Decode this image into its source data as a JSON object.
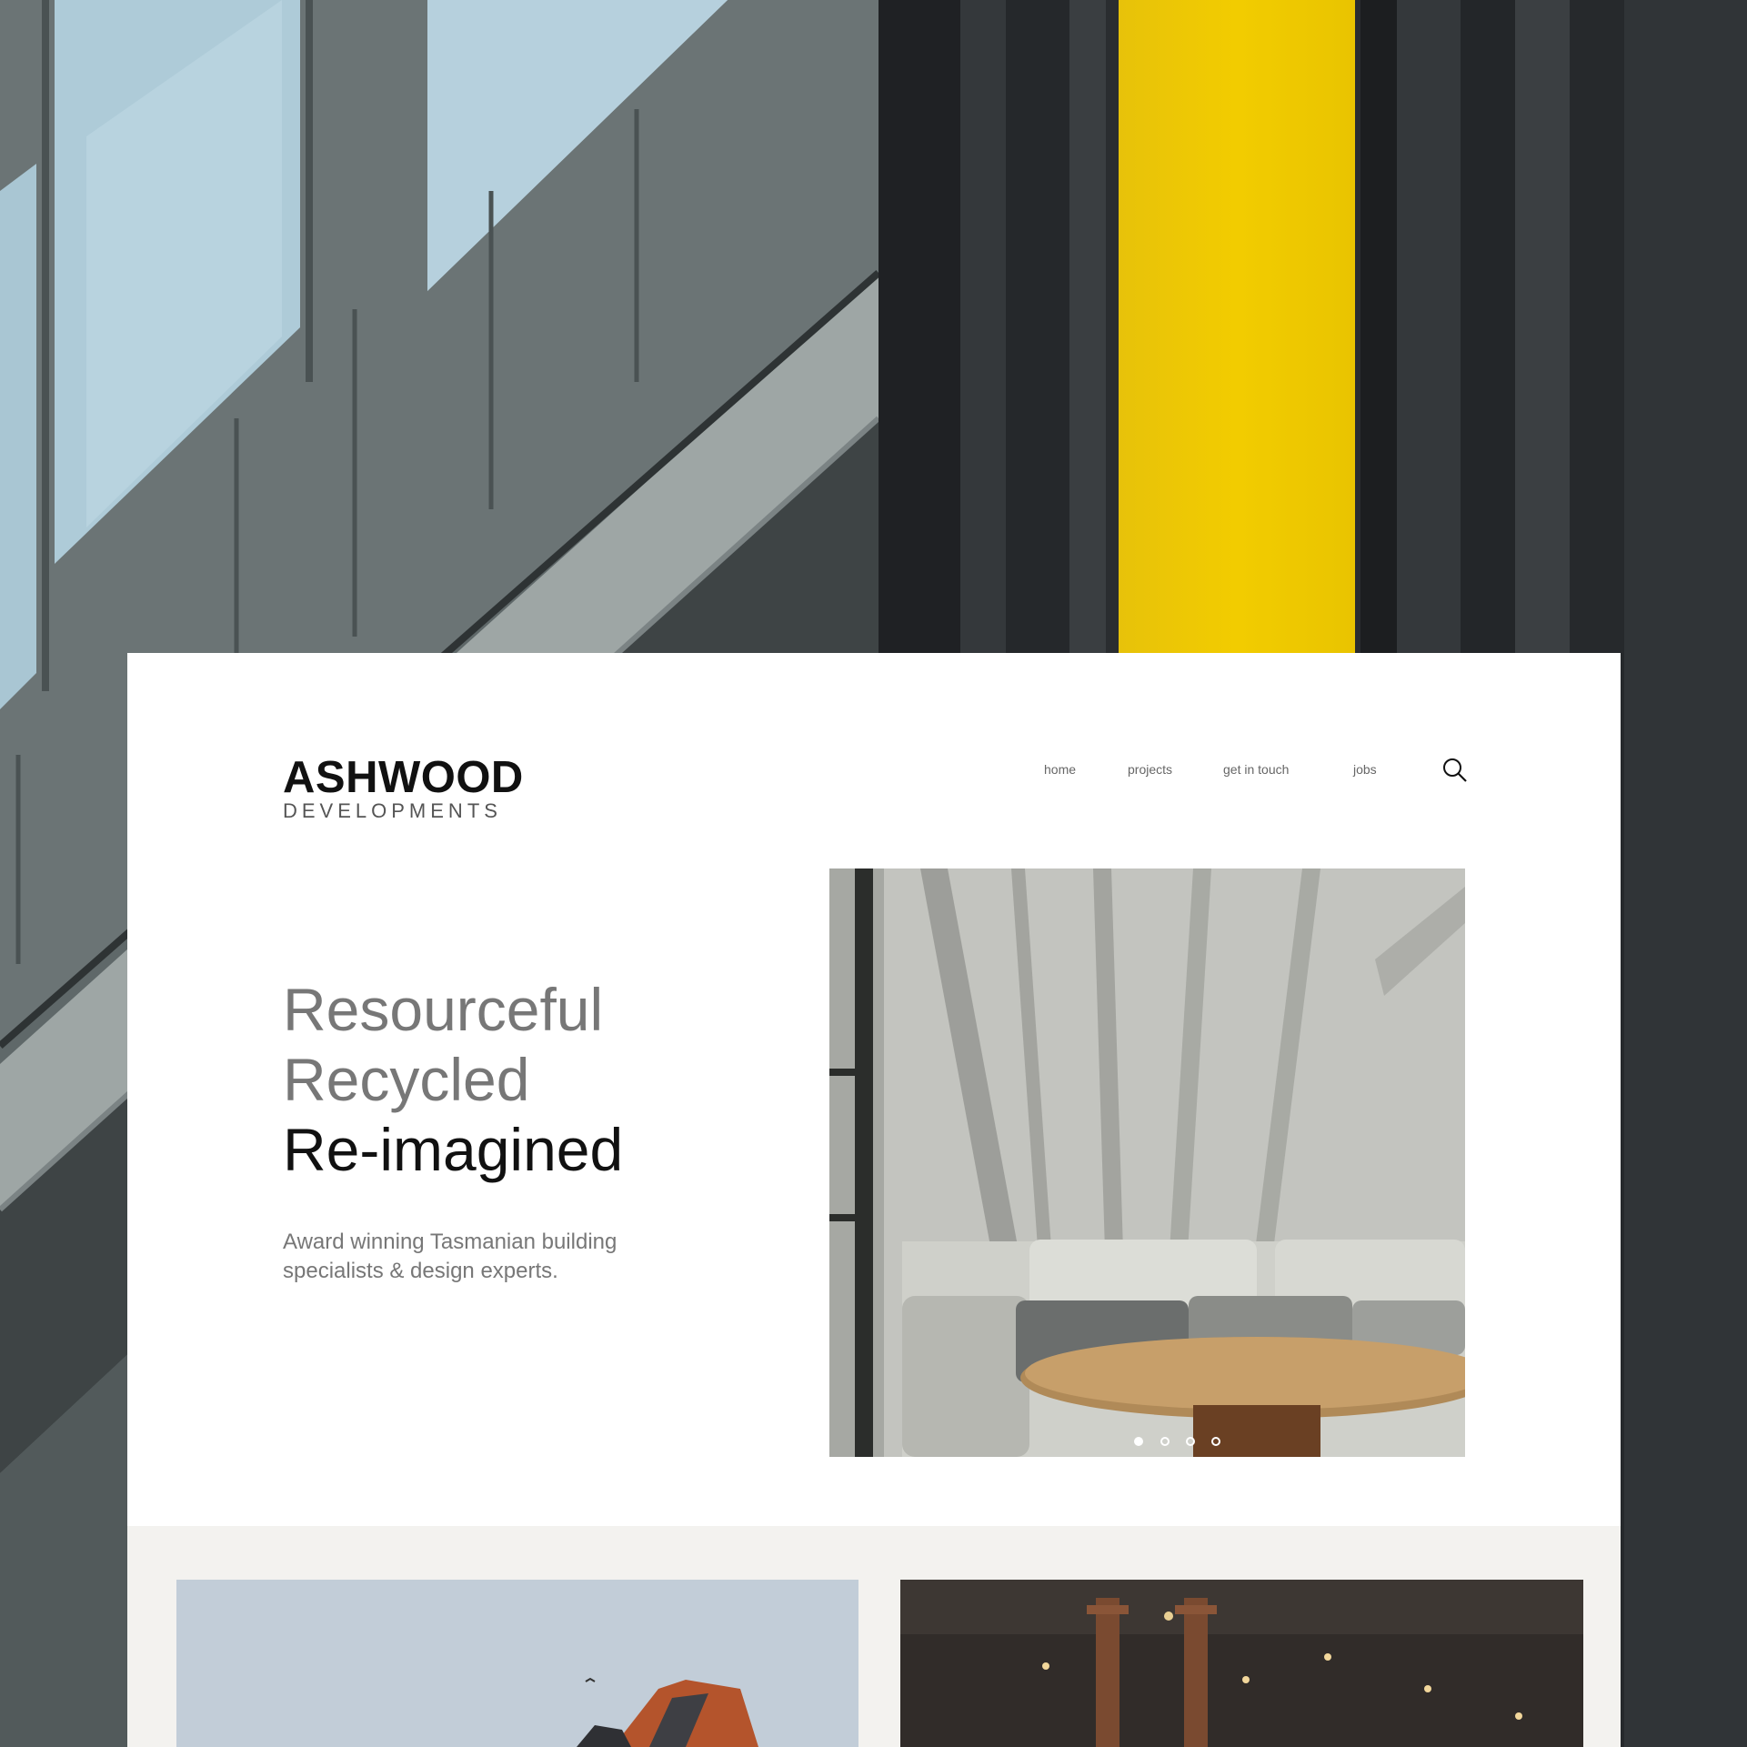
{
  "brand": {
    "name": "ASHWOOD",
    "tagline": "DEVELOPMENTS"
  },
  "nav": {
    "items": [
      "home",
      "projects",
      "get in touch",
      "jobs"
    ]
  },
  "search": {
    "icon": "search-icon"
  },
  "hero": {
    "lines": [
      "Resourceful",
      "Recycled",
      "Re-imagined"
    ],
    "subtitle": "Award winning Tasmanian building specialists & design experts.",
    "slides": {
      "count": 4,
      "active": 1
    }
  },
  "colors": {
    "accent_yellow": "#f2cc00",
    "text_dark": "#111111",
    "text_muted": "#777777",
    "lower_bg": "#f3f2ef"
  }
}
